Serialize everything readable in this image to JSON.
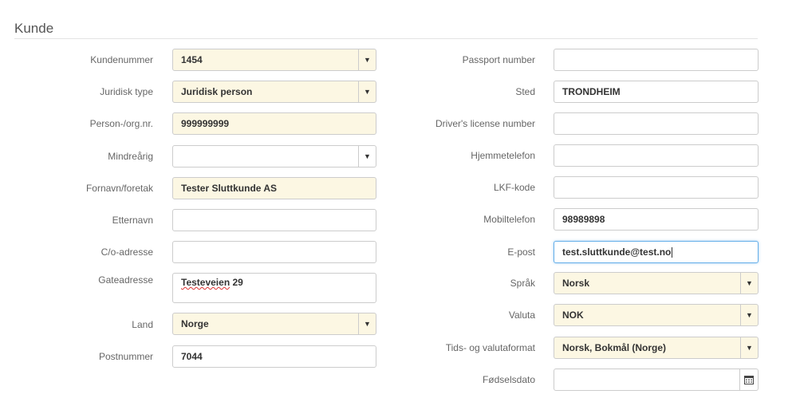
{
  "section": {
    "title": "Kunde"
  },
  "left": {
    "kundenummer": {
      "label": "Kundenummer",
      "value": "1454"
    },
    "juridisk_type": {
      "label": "Juridisk type",
      "value": "Juridisk person"
    },
    "person_org": {
      "label": "Person-/org.nr.",
      "value": "999999999"
    },
    "mindrearig": {
      "label": "Mindreårig",
      "value": ""
    },
    "fornavn": {
      "label": "Fornavn/foretak",
      "value": "Tester Sluttkunde AS"
    },
    "etternavn": {
      "label": "Etternavn",
      "value": ""
    },
    "co_adresse": {
      "label": "C/o-adresse",
      "value": ""
    },
    "gateadresse": {
      "label": "Gateadresse",
      "value_word1": "Testeveien",
      "value_rest": " 29"
    },
    "land": {
      "label": "Land",
      "value": "Norge"
    },
    "postnummer": {
      "label": "Postnummer",
      "value": "7044"
    }
  },
  "right": {
    "passport": {
      "label": "Passport number",
      "value": ""
    },
    "sted": {
      "label": "Sted",
      "value": "TRONDHEIM"
    },
    "drivers_license": {
      "label": "Driver's license number",
      "value": ""
    },
    "hjemmetelefon": {
      "label": "Hjemmetelefon",
      "value": ""
    },
    "lkf_kode": {
      "label": "LKF-kode",
      "value": ""
    },
    "mobiltelefon": {
      "label": "Mobiltelefon",
      "value": "98989898"
    },
    "epost": {
      "label": "E-post",
      "value": "test.sluttkunde@test.no"
    },
    "sprak": {
      "label": "Språk",
      "value": "Norsk"
    },
    "valuta": {
      "label": "Valuta",
      "value": "NOK"
    },
    "tidsformat": {
      "label": "Tids- og valutaformat",
      "value": "Norsk, Bokmål (Norge)"
    },
    "fodselsdato": {
      "label": "Fødselsdato",
      "value": ""
    }
  },
  "icons": {
    "caret": "caret-down-icon",
    "calendar": "calendar-icon"
  }
}
